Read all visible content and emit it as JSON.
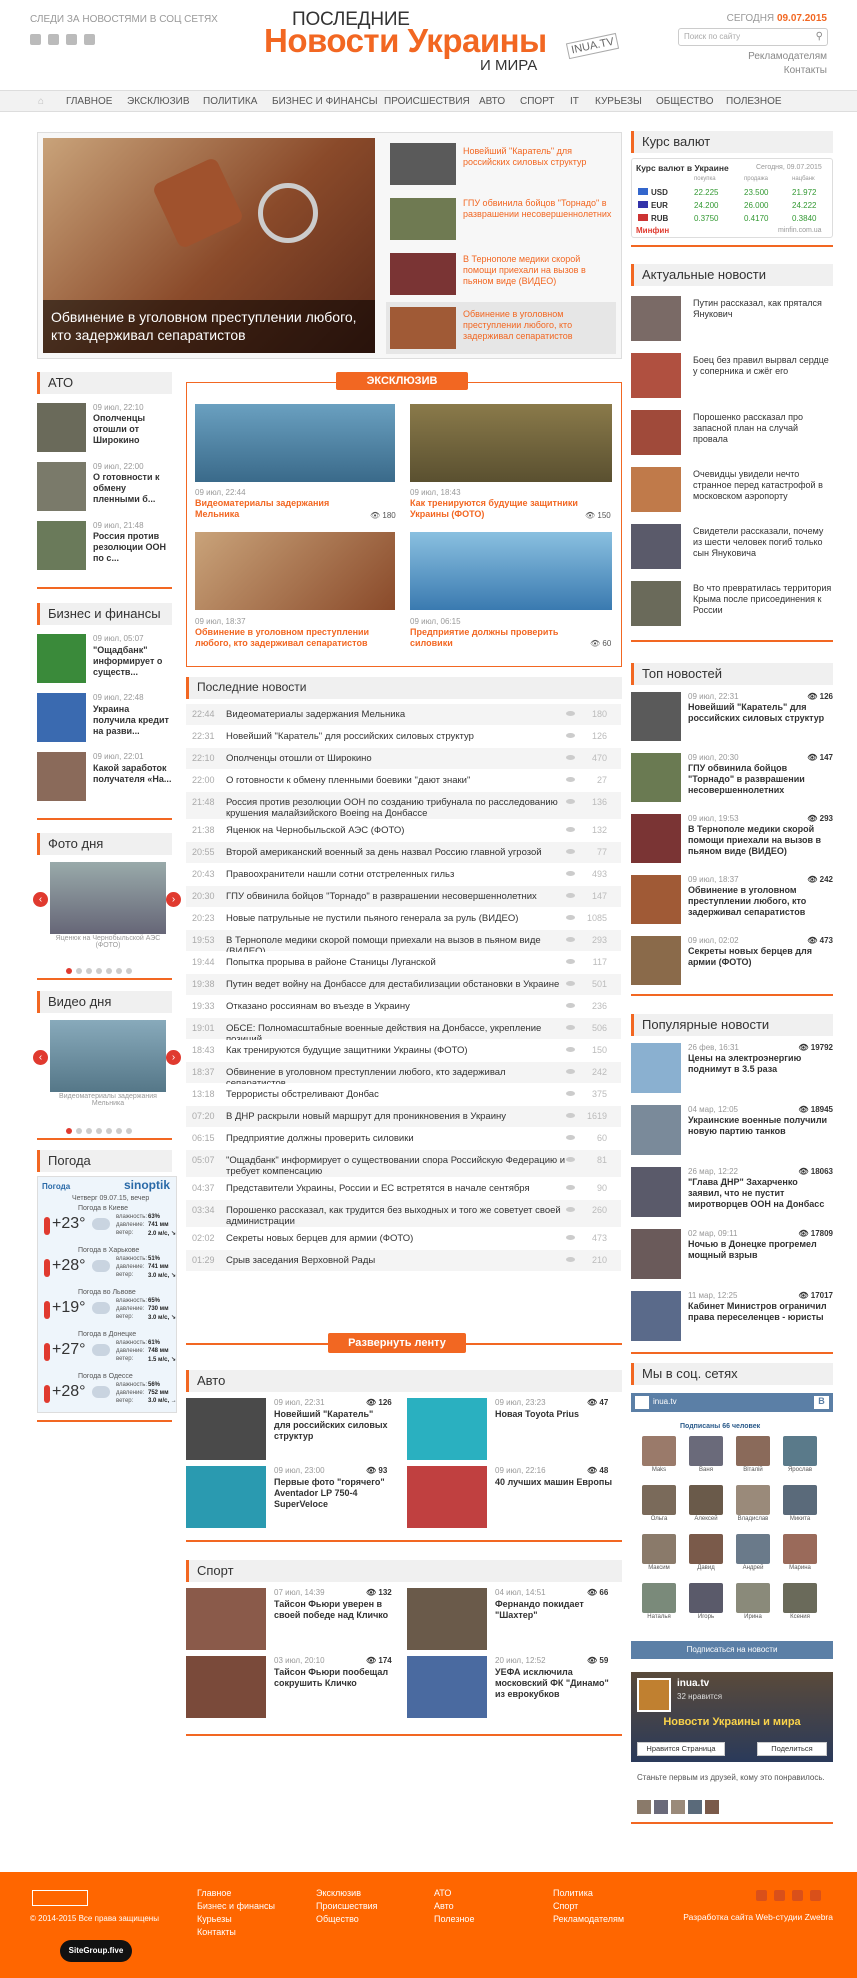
{
  "header": {
    "follow_text": "СЛЕДИ ЗА НОВОСТЯМИ В СОЦ СЕТЯХ",
    "logo_line1": "ПОСЛЕДНИЕ",
    "logo_line2": "Новости Украины",
    "logo_line3": "И МИРА",
    "logo_badge": "INUA.TV",
    "today_label": "СЕГОДНЯ",
    "today_date": "09.07.2015",
    "search_placeholder": "Поиск по сайту",
    "link_ads": "Рекламодателям",
    "link_contacts": "Контакты"
  },
  "nav": [
    "ГЛАВНОЕ",
    "ЭКСКЛЮЗИВ",
    "ПОЛИТИКА",
    "БИЗНЕС И ФИНАНСЫ",
    "ПРОИСШЕСТВИЯ",
    "АВТО",
    "СПОРТ",
    "IT",
    "КУРЬЕЗЫ",
    "ОБЩЕСТВО",
    "ПОЛЕЗНОЕ"
  ],
  "hero": {
    "caption": "Обвинение в уголовном преступлении любого, кто задерживал сепаратистов",
    "side": [
      "Новейший \"Каратель\" для российских силовых структур",
      "ГПУ обвинила бойцов \"Торнадо\" в разврашении несовершеннолетних",
      "В Тернополе медики скорой помощи приехали на вызов в пьяном виде (ВИДЕО)",
      "Обвинение в уголовном преступлении любого, кто задерживал сепаратистов"
    ]
  },
  "currency": {
    "title": "Курс валют",
    "widget_title": "Курс валют в Украине",
    "widget_date": "Сегодня, 09.07.2015",
    "col_buy": "покупка",
    "col_sell": "продажа",
    "col_nbu": "нацбанк",
    "rows": [
      {
        "code": "USD",
        "buy": "22.225",
        "sell": "23.500",
        "nbu": "21.972"
      },
      {
        "code": "EUR",
        "buy": "24.200",
        "sell": "26.000",
        "nbu": "24.222"
      },
      {
        "code": "RUB",
        "buy": "0.3750",
        "sell": "0.4170",
        "nbu": "0.3840"
      }
    ],
    "brand": "Минфин",
    "site": "minfin.com.ua"
  },
  "actual": {
    "title": "Актуальные новости",
    "items": [
      "Путин рассказал, как прятался Янукович",
      "Боец без правил вырвал сердце у соперника и сжёг его",
      "Порошенко рассказал про запасной план на случай провала",
      "Очевидцы увидели нечто странное перед катастрофой в московском аэропорту",
      "Свидетели рассказали, почему из шести человек погиб только сын Януковича",
      "Во что превратилась территория Крыма после присоединения к России"
    ]
  },
  "ato": {
    "title": "АТО",
    "items": [
      {
        "date": "09 июл, 22:10",
        "text": "Ополченцы отошли от Широкино"
      },
      {
        "date": "09 июл, 22:00",
        "text": "О готовности к обмену пленными б..."
      },
      {
        "date": "09 июл, 21:48",
        "text": "Россия против резолюции ООН по с..."
      }
    ]
  },
  "business": {
    "title": "Бизнес и финансы",
    "items": [
      {
        "date": "09 июл, 05:07",
        "text": "\"Ощадбанк\" информирует о существ..."
      },
      {
        "date": "09 июл, 22:48",
        "text": "Украина получила кредит на разви..."
      },
      {
        "date": "09 июл, 22:01",
        "text": "Какой заработок получателя «На..."
      }
    ]
  },
  "photo_day": {
    "title": "Фото дня",
    "caption": "Яценюк на Чернобыльской АЭС (ФОТО)"
  },
  "video_day": {
    "title": "Видео дня",
    "caption": "Видеоматериалы задержания Мельника"
  },
  "weather": {
    "title": "Погода",
    "widget": "Погода",
    "brand": "sinoptik",
    "sub": "Четверг 09.07.15, вечер",
    "lbl_hum": "влажность:",
    "lbl_pres": "давление:",
    "lbl_wind": "ветер:",
    "cities": [
      {
        "name": "Погода в Киеве",
        "temp": "+23°",
        "hum": "63%",
        "pres": "741 мм",
        "wind": "2.0 м/с, ↘"
      },
      {
        "name": "Погода в Харькове",
        "temp": "+28°",
        "hum": "51%",
        "pres": "741 мм",
        "wind": "3.0 м/с, ↘"
      },
      {
        "name": "Погода во Львове",
        "temp": "+19°",
        "hum": "65%",
        "pres": "730 мм",
        "wind": "3.0 м/с, ↘"
      },
      {
        "name": "Погода в Донецке",
        "temp": "+27°",
        "hum": "61%",
        "pres": "748 мм",
        "wind": "1.5 м/с, ↘"
      },
      {
        "name": "Погода в Одессе",
        "temp": "+28°",
        "hum": "56%",
        "pres": "752 мм",
        "wind": "3.0 м/с, →"
      }
    ]
  },
  "exclusive": {
    "label": "ЭКСКЛЮЗИВ",
    "items": [
      {
        "date": "09 июл, 22:44",
        "title": "Видеоматериалы задержания Мельника",
        "views": "180"
      },
      {
        "date": "09 июл, 18:43",
        "title": "Как тренируются будущие защитники Украины (ФОТО)",
        "views": "150"
      },
      {
        "date": "09 июл, 18:37",
        "title": "Обвинение в уголовном преступлении любого, кто задерживал сепаратистов",
        "views": ""
      },
      {
        "date": "09 июл, 06:15",
        "title": "Предприятие должны проверить силовики",
        "views": "60"
      }
    ]
  },
  "feed": {
    "title": "Последние новости",
    "button": "Развернуть ленту",
    "rows": [
      {
        "t": "22:44",
        "x": "Видеоматериалы задержания Мельника",
        "v": "180"
      },
      {
        "t": "22:31",
        "x": "Новейший \"Каратель\" для российских силовых структур",
        "v": "126"
      },
      {
        "t": "22:10",
        "x": "Ополченцы отошли от Широкино",
        "v": "470"
      },
      {
        "t": "22:00",
        "x": "О готовности к обмену пленными боевики \"дают знаки\"",
        "v": "27"
      },
      {
        "t": "21:48",
        "x": "Россия против резолюции ООН по созданию трибунала по расследованию крушения малайзийского Boeing на Донбассе",
        "v": "136"
      },
      {
        "t": "21:38",
        "x": "Яценюк на Чернобыльской АЭС (ФОТО)",
        "v": "132"
      },
      {
        "t": "20:55",
        "x": "Второй американский военный за день назвал Россию главной угрозой",
        "v": "77"
      },
      {
        "t": "20:43",
        "x": "Правоохранители нашли сотни отстреленных гильз",
        "v": "493"
      },
      {
        "t": "20:30",
        "x": "ГПУ обвинила бойцов \"Торнадо\" в разврашении несовершеннолетних",
        "v": "147"
      },
      {
        "t": "20:23",
        "x": "Новые патрульные не пустили пьяного генерала за руль (ВИДЕО)",
        "v": "1085"
      },
      {
        "t": "19:53",
        "x": "В Тернополе медики скорой помощи приехали на вызов в пьяном виде (ВИДЕО)",
        "v": "293"
      },
      {
        "t": "19:44",
        "x": "Попытка прорыва в районе Станицы Луганской",
        "v": "117"
      },
      {
        "t": "19:38",
        "x": "Путин ведет войну на Донбассе для дестабилизации обстановки в Украине",
        "v": "501"
      },
      {
        "t": "19:33",
        "x": "Отказано россиянам во въезде в Украину",
        "v": "236"
      },
      {
        "t": "19:01",
        "x": "ОБСЕ: Полномасштабные военные действия на Донбассе, укрепление позиций",
        "v": "506"
      },
      {
        "t": "18:43",
        "x": "Как тренируются будущие защитники Украины (ФОТО)",
        "v": "150"
      },
      {
        "t": "18:37",
        "x": "Обвинение в уголовном преступлении любого, кто задерживал сепаратистов",
        "v": "242"
      },
      {
        "t": "13:18",
        "x": "Террористы обстреливают Донбас",
        "v": "375"
      },
      {
        "t": "07:20",
        "x": "В ДНР раскрыли новый маршрут для проникновения в Украину",
        "v": "1619"
      },
      {
        "t": "06:15",
        "x": "Предприятие должны проверить силовики",
        "v": "60"
      },
      {
        "t": "05:07",
        "x": "\"Ощадбанк\" информирует о существовании спора Российскую Федерацию и требует компенсацию",
        "v": "81"
      },
      {
        "t": "04:37",
        "x": "Представители Украины, России и ЕС встретятся в начале сентября",
        "v": "90"
      },
      {
        "t": "03:34",
        "x": "Порошенко рассказал, как трудится без выходных и того же советует своей администрации",
        "v": "260"
      },
      {
        "t": "02:02",
        "x": "Секреты новых берцев для армии (ФОТО)",
        "v": "473"
      },
      {
        "t": "01:29",
        "x": "Срыв заседания Верховной Рады",
        "v": "210"
      }
    ]
  },
  "top": {
    "title": "Топ новостей",
    "items": [
      {
        "date": "09 июл, 22:31",
        "text": "Новейший \"Каратель\" для российских силовых структур",
        "views": "126"
      },
      {
        "date": "09 июл, 20:30",
        "text": "ГПУ обвинила бойцов \"Торнадо\" в разврашении несовершеннолетних",
        "views": "147"
      },
      {
        "date": "09 июл, 19:53",
        "text": "В Тернополе медики скорой помощи приехали на вызов в пьяном виде (ВИДЕО)",
        "views": "293"
      },
      {
        "date": "09 июл, 18:37",
        "text": "Обвинение в уголовном преступлении любого, кто задерживал сепаратистов",
        "views": "242"
      },
      {
        "date": "09 июл, 02:02",
        "text": "Секреты новых берцев для армии (ФОТО)",
        "views": "473"
      }
    ]
  },
  "popular": {
    "title": "Популярные новости",
    "items": [
      {
        "date": "26 фев, 16:31",
        "text": "Цены на электроэнергию поднимут в 3.5 раза",
        "views": "19792"
      },
      {
        "date": "04 мар, 12:05",
        "text": "Украинские военные получили новую партию танков",
        "views": "18945"
      },
      {
        "date": "26 мар, 12:22",
        "text": "\"Глава ДНР\" Захарченко заявил, что не пустит миротворцев ООН на Донбасс",
        "views": "18063"
      },
      {
        "date": "02 мар, 09:11",
        "text": "Ночью в Донецке прогремел мощный взрыв",
        "views": "17809"
      },
      {
        "date": "11 мар, 12:25",
        "text": "Кабинет Министров ограничил права переселенцев - юристы",
        "views": "17017"
      }
    ]
  },
  "auto": {
    "title": "Авто",
    "items": [
      {
        "date": "09 июл, 22:31",
        "text": "Новейший \"Каратель\" для российских силовых структур",
        "views": "126"
      },
      {
        "date": "09 июл, 23:23",
        "text": "Новая Toyota Prius",
        "views": "47"
      },
      {
        "date": "09 июл, 23:00",
        "text": "Первые фото \"горячего\" Aventador LP 750-4 SuperVeloce",
        "views": "93"
      },
      {
        "date": "09 июл, 22:16",
        "text": "40 лучших машин Европы",
        "views": "48"
      }
    ]
  },
  "sport": {
    "title": "Спорт",
    "items": [
      {
        "date": "07 июл, 14:39",
        "text": "Тайсон Фьюри уверен в своей победе над Кличко",
        "views": "132"
      },
      {
        "date": "04 июл, 14:51",
        "text": "Фернандо покидает \"Шахтер\"",
        "views": "66"
      },
      {
        "date": "03 июл, 20:10",
        "text": "Тайсон Фьюри пообещал сокрушить Кличко",
        "views": "174"
      },
      {
        "date": "20 июл, 12:52",
        "text": "УЕФА исключила московский ФК \"Динамо\" из еврокубков",
        "views": "59"
      }
    ]
  },
  "social": {
    "title": "Мы в соц. сетях",
    "vk_name": "inua.tv",
    "subscribers": "Подписаны 66 человек",
    "names": [
      "Maks",
      "Ваня",
      "Віталій",
      "Ярослав",
      "Ольга",
      "Алексей",
      "Владислав",
      "Микита",
      "Максим",
      "Давид",
      "Андрей",
      "Марина",
      "Наталья",
      "Игорь",
      "Ирина",
      "Ксения"
    ],
    "subscribe_btn": "Подписаться на новости",
    "fb_name": "inua.tv",
    "fb_likes": "32 нравится",
    "fb_banner": "Новости Украины и мира",
    "fb_like_btn": "Нравится Страница",
    "fb_share_btn": "Поделиться",
    "fb_text": "Станьте первым из друзей, кому это понравилось."
  },
  "footer": {
    "copyright": "© 2014-2015 Все права защищены",
    "sitegroup": "SiteGroup.five",
    "col1": [
      "Главное",
      "Бизнес и финансы",
      "Курьезы",
      "Контакты"
    ],
    "col2": [
      "Эксклюзив",
      "Происшествия",
      "Общество"
    ],
    "col3": [
      "АТО",
      "Авто",
      "Полезное"
    ],
    "col4": [
      "Политика",
      "Спорт",
      "Рекламодателям"
    ],
    "dev": "Разработка сайта Web-студии Zwebra"
  }
}
